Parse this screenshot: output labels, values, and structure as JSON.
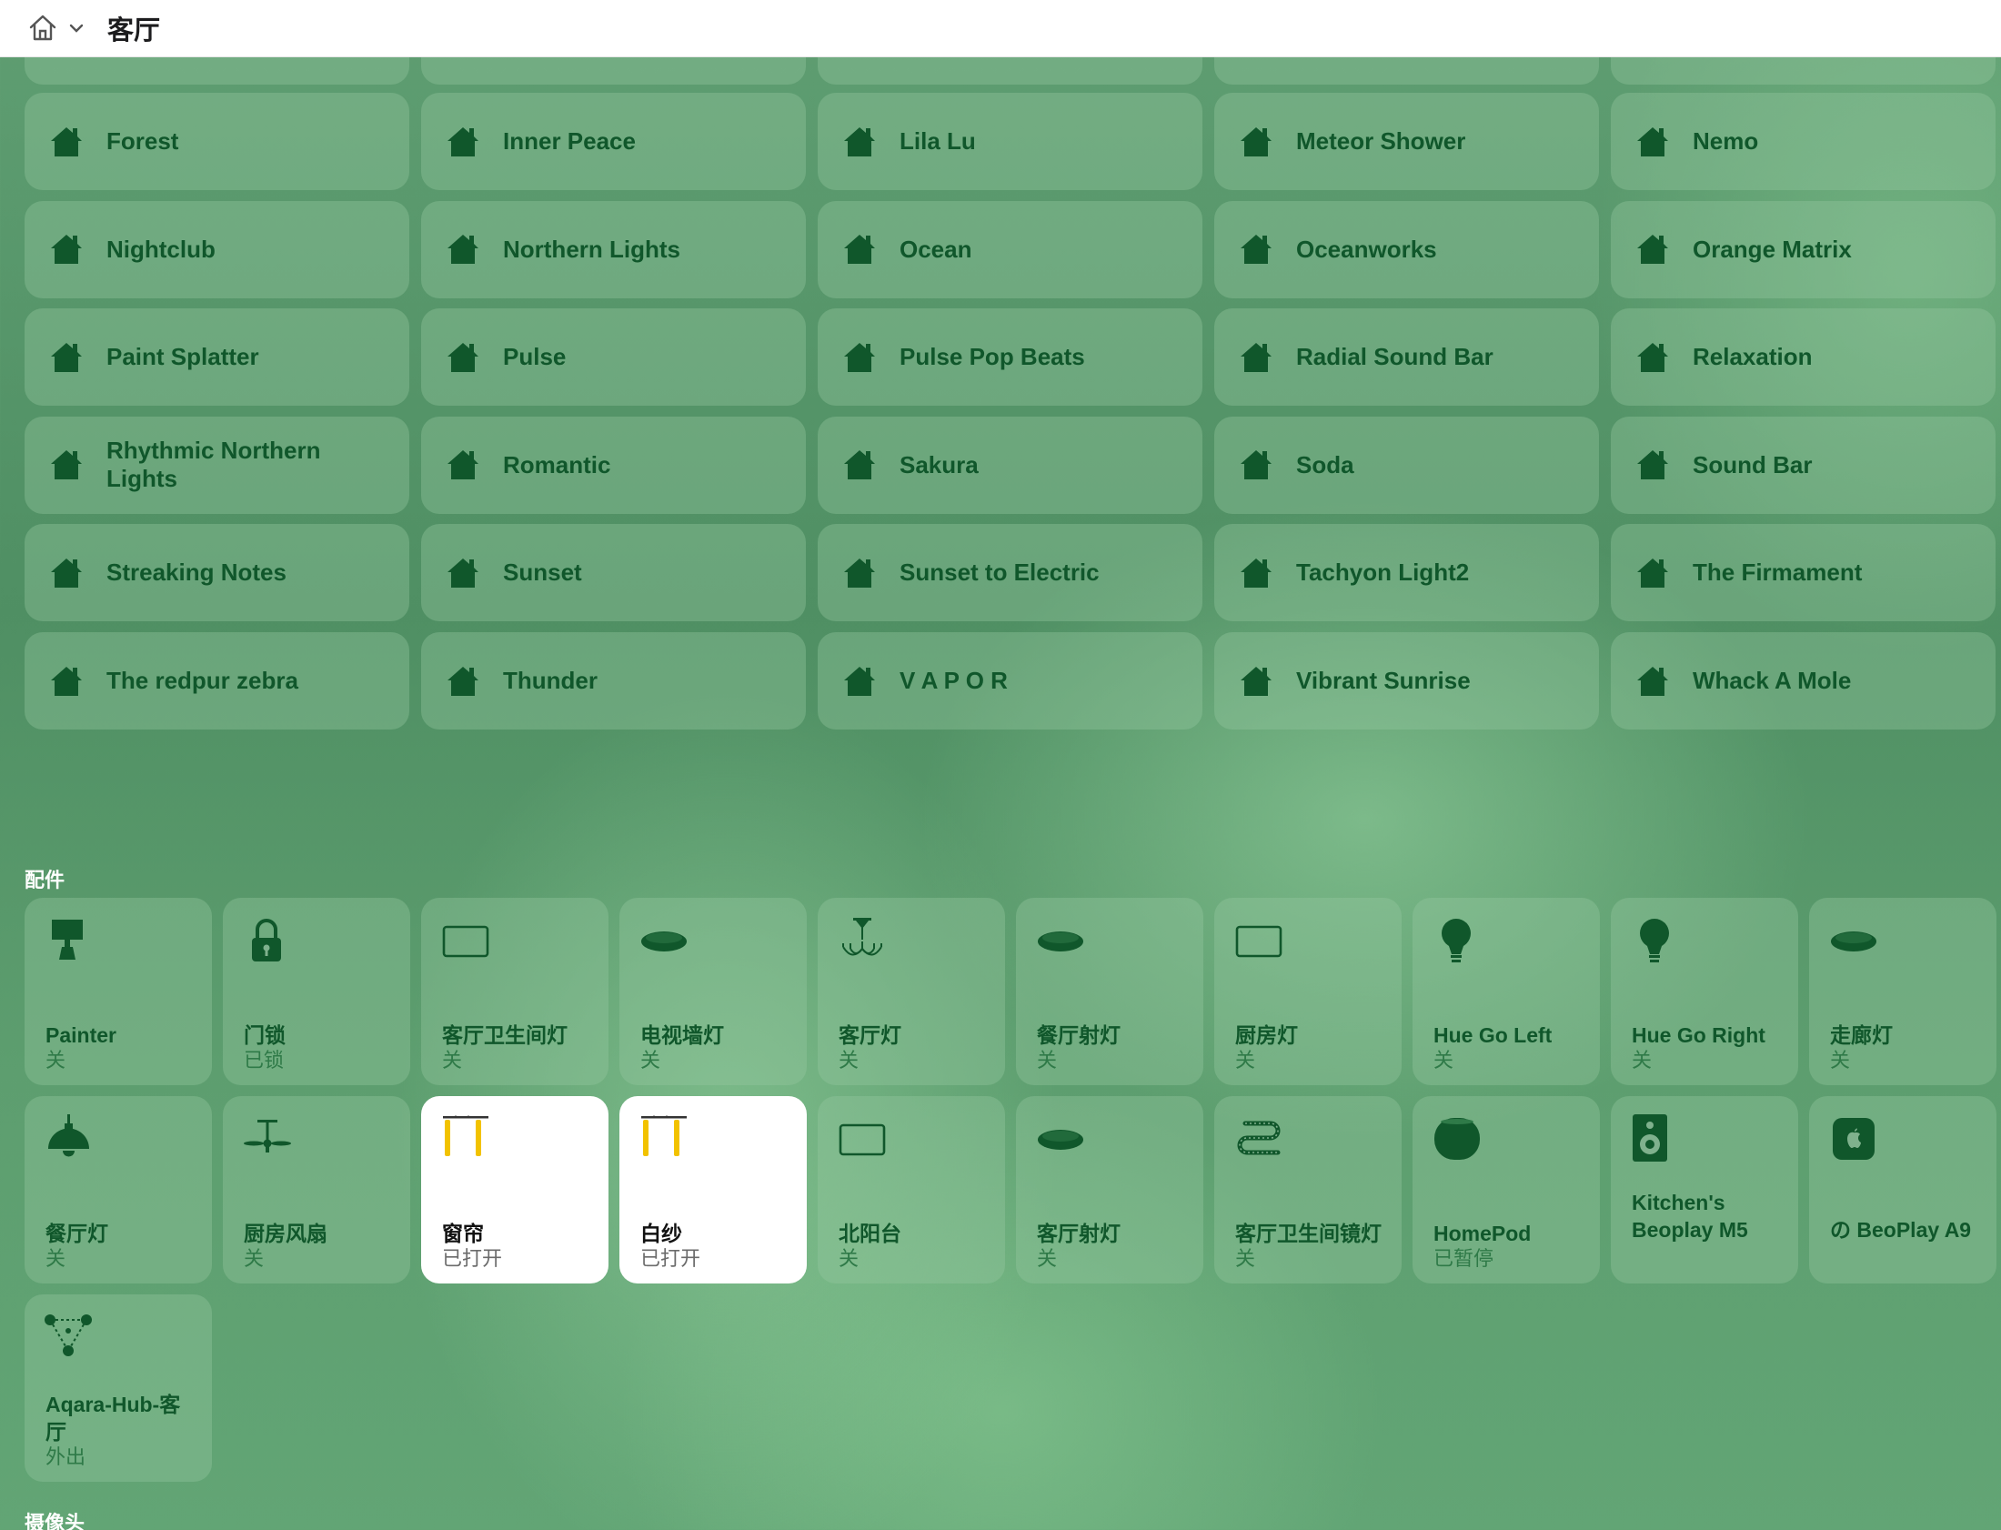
{
  "topbar": {
    "title": "客厅"
  },
  "scenes": [
    "Forest",
    "Inner Peace",
    "Lila Lu",
    "Meteor Shower",
    "Nemo",
    "Nightclub",
    "Northern Lights",
    "Ocean",
    "Oceanworks",
    "Orange Matrix",
    "Paint Splatter",
    "Pulse",
    "Pulse Pop Beats",
    "Radial Sound Bar",
    "Relaxation",
    "Rhythmic Northern Lights",
    "Romantic",
    "Sakura",
    "Soda",
    "Sound Bar",
    "Streaking Notes",
    "Sunset",
    "Sunset to Electric",
    "Tachyon Light2",
    "The Firmament",
    "The redpur zebra",
    "Thunder",
    "V A P O R",
    "Vibrant Sunrise",
    "Whack A Mole"
  ],
  "sections": {
    "accessories": "配件",
    "cameras": "摄像头"
  },
  "accessories": [
    {
      "name": "Painter",
      "status": "关",
      "icon": "lamp-icon",
      "active": false
    },
    {
      "name": "门锁",
      "status": "已锁",
      "icon": "lock-icon",
      "active": false
    },
    {
      "name": "客厅卫生间灯",
      "status": "关",
      "icon": "panel-light-icon",
      "active": false
    },
    {
      "name": "电视墙灯",
      "status": "关",
      "icon": "downlight-icon",
      "active": false
    },
    {
      "name": "客厅灯",
      "status": "关",
      "icon": "chandelier-icon",
      "active": false
    },
    {
      "name": "餐厅射灯",
      "status": "关",
      "icon": "downlight-icon",
      "active": false
    },
    {
      "name": "厨房灯",
      "status": "关",
      "icon": "panel-light-icon",
      "active": false
    },
    {
      "name": "Hue Go Left",
      "status": "关",
      "icon": "bulb-icon",
      "active": false
    },
    {
      "name": "Hue Go Right",
      "status": "关",
      "icon": "bulb-icon",
      "active": false
    },
    {
      "name": "走廊灯",
      "status": "关",
      "icon": "downlight-icon",
      "active": false
    },
    {
      "name": "餐厅灯",
      "status": "关",
      "icon": "pendant-light-icon",
      "active": false
    },
    {
      "name": "厨房风扇",
      "status": "关",
      "icon": "ceiling-fan-icon",
      "active": false
    },
    {
      "name": "窗帘",
      "status": "已打开",
      "icon": "curtain-icon",
      "active": true
    },
    {
      "name": "白纱",
      "status": "已打开",
      "icon": "curtain-icon",
      "active": true
    },
    {
      "name": "北阳台",
      "status": "关",
      "icon": "panel-light-icon",
      "active": false
    },
    {
      "name": "客厅射灯",
      "status": "关",
      "icon": "downlight-icon",
      "active": false
    },
    {
      "name": "客厅卫生间镜灯",
      "status": "关",
      "icon": "light-strip-icon",
      "active": false
    },
    {
      "name": "HomePod",
      "status": "已暂停",
      "icon": "homepod-icon",
      "active": false
    },
    {
      "name": "Kitchen's Beoplay M5",
      "status": "",
      "icon": "speaker-icon",
      "active": false
    },
    {
      "name": "の BeoPlay A9",
      "status": "",
      "icon": "apple-tv-icon",
      "active": false
    },
    {
      "name": "Aqara-Hub-客厅",
      "status": "外出",
      "icon": "hub-icon",
      "active": false
    }
  ],
  "colors": {
    "tile_text": "#10572b",
    "curtain": "#f2c200",
    "topbar": "#ffffff"
  }
}
